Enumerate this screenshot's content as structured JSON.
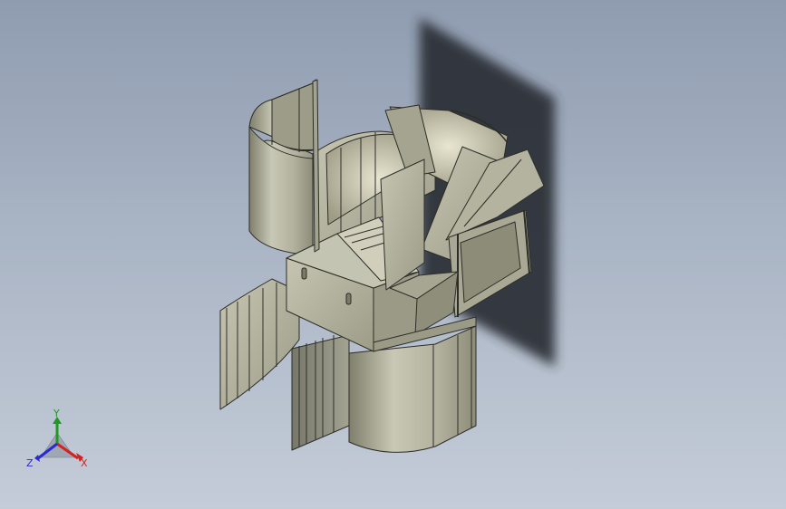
{
  "triad": {
    "x_label": "X",
    "y_label": "Y",
    "z_label": "Z",
    "colors": {
      "x": "#d42020",
      "y": "#1f9a1f",
      "z": "#2a2ad0"
    }
  },
  "model": {
    "icon": "3d-sheet-metal-assembly",
    "colors": {
      "body": "#b9b9a6",
      "body_dark": "#8f8f7c",
      "edge": "#2d2d28",
      "shadow": "#2a2e34"
    }
  }
}
